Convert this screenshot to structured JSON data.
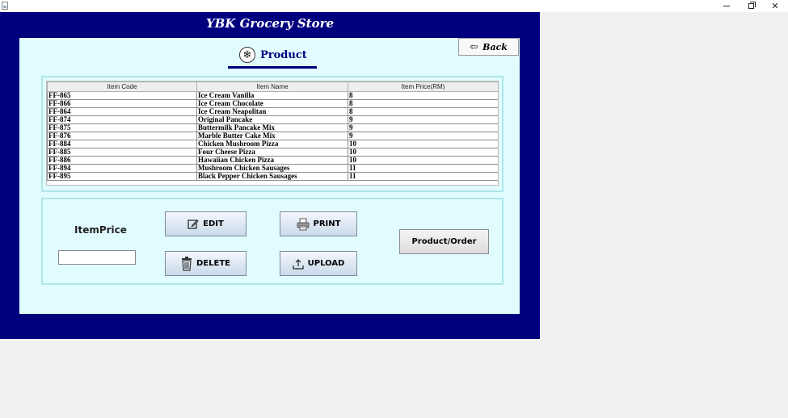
{
  "window": {
    "minimize_glyph": "minimize-icon",
    "maximize_glyph": "restore-icon",
    "close_label": "✕"
  },
  "app": {
    "title": "YBK Grocery Store",
    "frame_color": "#00007f",
    "content_color": "#e1fcff"
  },
  "header": {
    "back_label": "Back",
    "page_title": "Product",
    "logo_icon": "snowflake-logo-icon"
  },
  "table": {
    "columns": [
      "Item Code",
      "Item Name",
      "Item Price(RM)"
    ],
    "rows": [
      [
        "FF-865",
        "Ice Cream Vanilla",
        "8"
      ],
      [
        "FF-866",
        "Ice Cream Chocolate",
        "8"
      ],
      [
        "FF-864",
        "Ice Cream Neapolitan",
        "8"
      ],
      [
        "FF-874",
        "Original Pancake",
        "9"
      ],
      [
        "FF-875",
        "Buttermilk Pancake Mix",
        "9"
      ],
      [
        "FF-876",
        "Marble Butter Cake Mix",
        "9"
      ],
      [
        "FF-884",
        "Chicken Mushroom Pizza",
        "10"
      ],
      [
        "FF-885",
        "Four Cheese Pizza",
        "10"
      ],
      [
        "FF-886",
        "Hawaiian Chicken Pizza",
        "10"
      ],
      [
        "FF-894",
        "Mushroom Chicken Sausages",
        "11"
      ],
      [
        "FF-895",
        "Black Pepper Chicken Sausages",
        "11"
      ]
    ]
  },
  "actions": {
    "price_label": "ItemPrice",
    "price_value": "",
    "edit_label": "EDIT",
    "delete_label": "DELETE",
    "print_label": "PRINT",
    "upload_label": "UPLOAD",
    "product_order_label": "Product/Order"
  }
}
